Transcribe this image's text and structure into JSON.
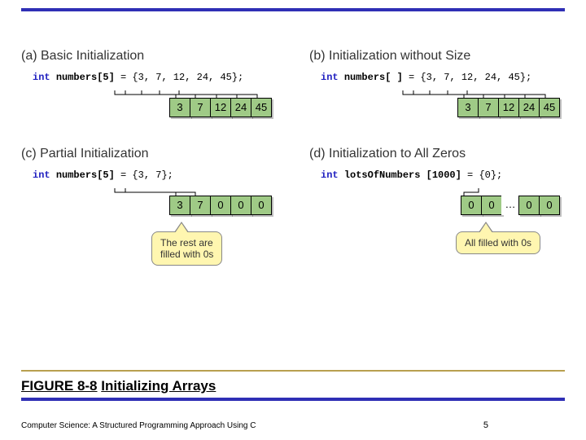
{
  "panels": {
    "a": {
      "label": "(a) Basic Initialization",
      "code_kw": "int",
      "code_name": "numbers[5]",
      "code_rest": " = {3, 7, 12, 24, 45};",
      "cells": [
        "3",
        "7",
        "12",
        "24",
        "45"
      ]
    },
    "b": {
      "label": "(b) Initialization without Size",
      "code_kw": "int",
      "code_name": "numbers[ ]",
      "code_rest": " = {3, 7, 12, 24, 45};",
      "cells": [
        "3",
        "7",
        "12",
        "24",
        "45"
      ]
    },
    "c": {
      "label": "(c) Partial Initialization",
      "code_kw": "int",
      "code_name": "numbers[5]",
      "code_rest": " = {3, 7};",
      "cells": [
        "3",
        "7",
        "0",
        "0",
        "0"
      ],
      "callout": "The rest are\nfilled with 0s"
    },
    "d": {
      "label": "(d) Initialization to All Zeros",
      "code_kw": "int",
      "code_name": "lotsOfNumbers [1000]",
      "code_rest": " = {0};",
      "cells": [
        "0",
        "0",
        "…",
        "0",
        "0"
      ],
      "callout": "All filled with 0s"
    }
  },
  "caption_fig": "FIGURE 8-8",
  "caption_title": "Initializing Arrays",
  "footer_left": "Computer Science: A Structured Programming Approach Using C",
  "footer_right": "5"
}
